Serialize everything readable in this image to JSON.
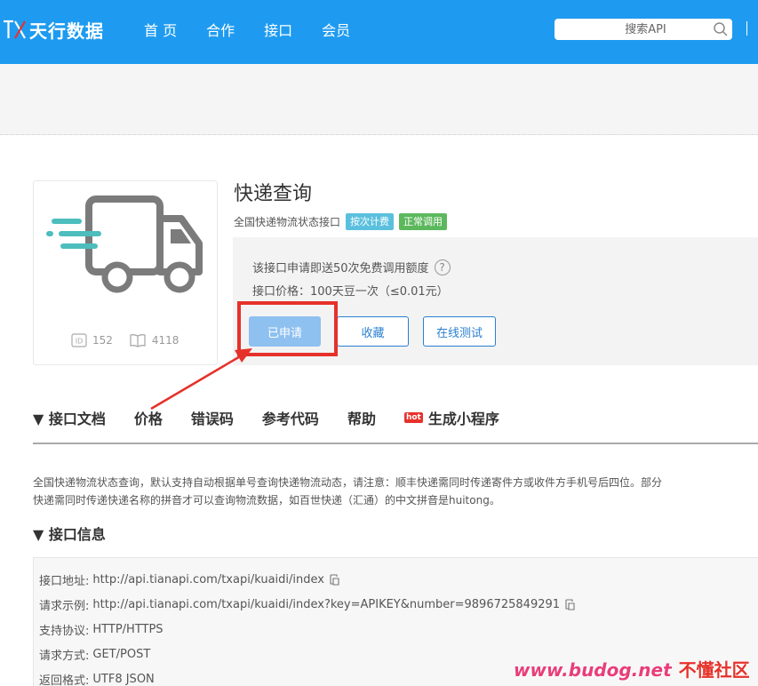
{
  "header": {
    "logo_text": "天行数据",
    "logo_mark": "TX",
    "nav": [
      "首 页",
      "合作",
      "接口",
      "会员"
    ],
    "search_placeholder": "搜索API"
  },
  "api": {
    "title": "快递查询",
    "subtitle": "全国快递物流状态接口",
    "tags": [
      "按次计费",
      "正常调用"
    ],
    "id_value": "152",
    "views_value": "4118",
    "free_note": "该接口申请即送50次免费调用额度",
    "price": "接口价格：100天豆一次（≤0.01元）",
    "buttons": {
      "applied": "已申请",
      "favorite": "收藏",
      "test": "在线测试"
    }
  },
  "tabs": {
    "items": [
      "▼ 接口文档",
      "价格",
      "错误码",
      "参考代码",
      "帮助"
    ],
    "mini_program_hot": "hot",
    "mini_program": "生成小程序"
  },
  "description": {
    "line1": "全国快递物流状态查询，默认支持自动根据单号查询快递物流动态，请注意：顺丰快递需同时传递寄件方或收件方手机号后四位。部分",
    "line2": "快递需同时传递快递名称的拼音才可以查询物流数据，如百世快递（汇通）的中文拼音是huitong。"
  },
  "info_section": {
    "title": "▼ 接口信息",
    "rows": [
      {
        "label": "接口地址:",
        "value": "http://api.tianapi.com/txapi/kuaidi/index"
      },
      {
        "label": "请求示例:",
        "value": "http://api.tianapi.com/txapi/kuaidi/index?key=APIKEY&number=9896725849291"
      },
      {
        "label": "支持协议:",
        "value": "HTTP/HTTPS"
      },
      {
        "label": "请求方式:",
        "value": "GET/POST"
      },
      {
        "label": "返回格式:",
        "value": "UTF8 JSON"
      }
    ]
  },
  "watermark": {
    "url": "www.budog.net",
    "name": "不懂社区"
  },
  "colors": {
    "header_bg": "#1e9bf0",
    "tag_blue": "#5bc0de",
    "tag_green": "#5cb85c",
    "highlight_red": "#e6312a",
    "applied_button": "#8ec0f0"
  }
}
